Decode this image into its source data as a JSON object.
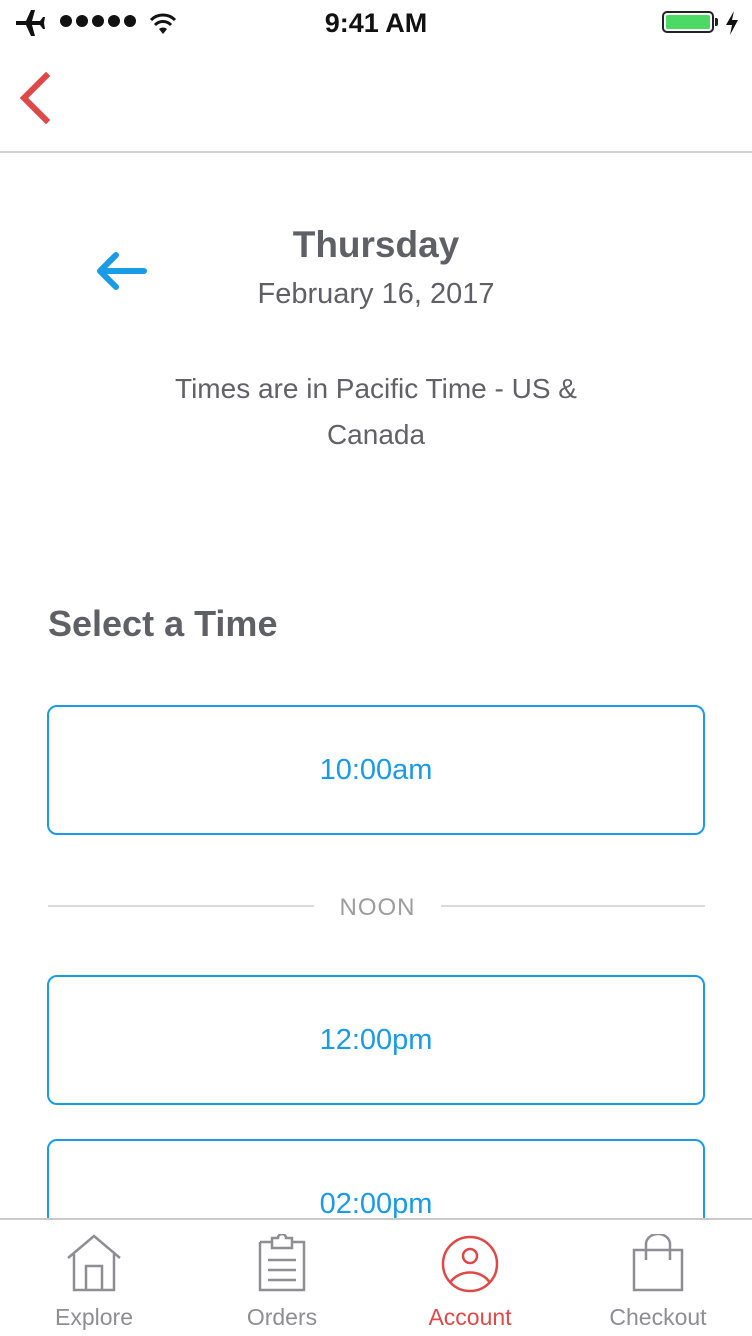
{
  "status_bar": {
    "time": "9:41 AM",
    "signal_dots": 5,
    "battery_percent": 100,
    "battery_color": "#4cd964",
    "icons": [
      "airplane-icon",
      "signal-icon",
      "wifi-icon",
      "battery-icon",
      "charging-bolt-icon"
    ]
  },
  "nav": {
    "back_icon": "chevron-left-icon",
    "accent_color": "#e04848"
  },
  "date_header": {
    "prev_icon": "arrow-left-icon",
    "day": "Thursday",
    "date": "February 16, 2017",
    "timezone_note": "Times are in Pacific Time - US & Canada"
  },
  "time_selection": {
    "title": "Select a Time",
    "accent_color": "#1a9be6",
    "slots_before_divider": [
      {
        "label": "10:00am"
      }
    ],
    "divider_label": "NOON",
    "slots_after_divider": [
      {
        "label": "12:00pm"
      },
      {
        "label": "02:00pm"
      }
    ]
  },
  "tab_bar": {
    "active_color": "#e04848",
    "items": [
      {
        "label": "Explore",
        "icon": "house-icon",
        "active": false
      },
      {
        "label": "Orders",
        "icon": "clipboard-icon",
        "active": false
      },
      {
        "label": "Account",
        "icon": "user-circle-icon",
        "active": true
      },
      {
        "label": "Checkout",
        "icon": "shopping-bag-icon",
        "active": false
      }
    ]
  }
}
